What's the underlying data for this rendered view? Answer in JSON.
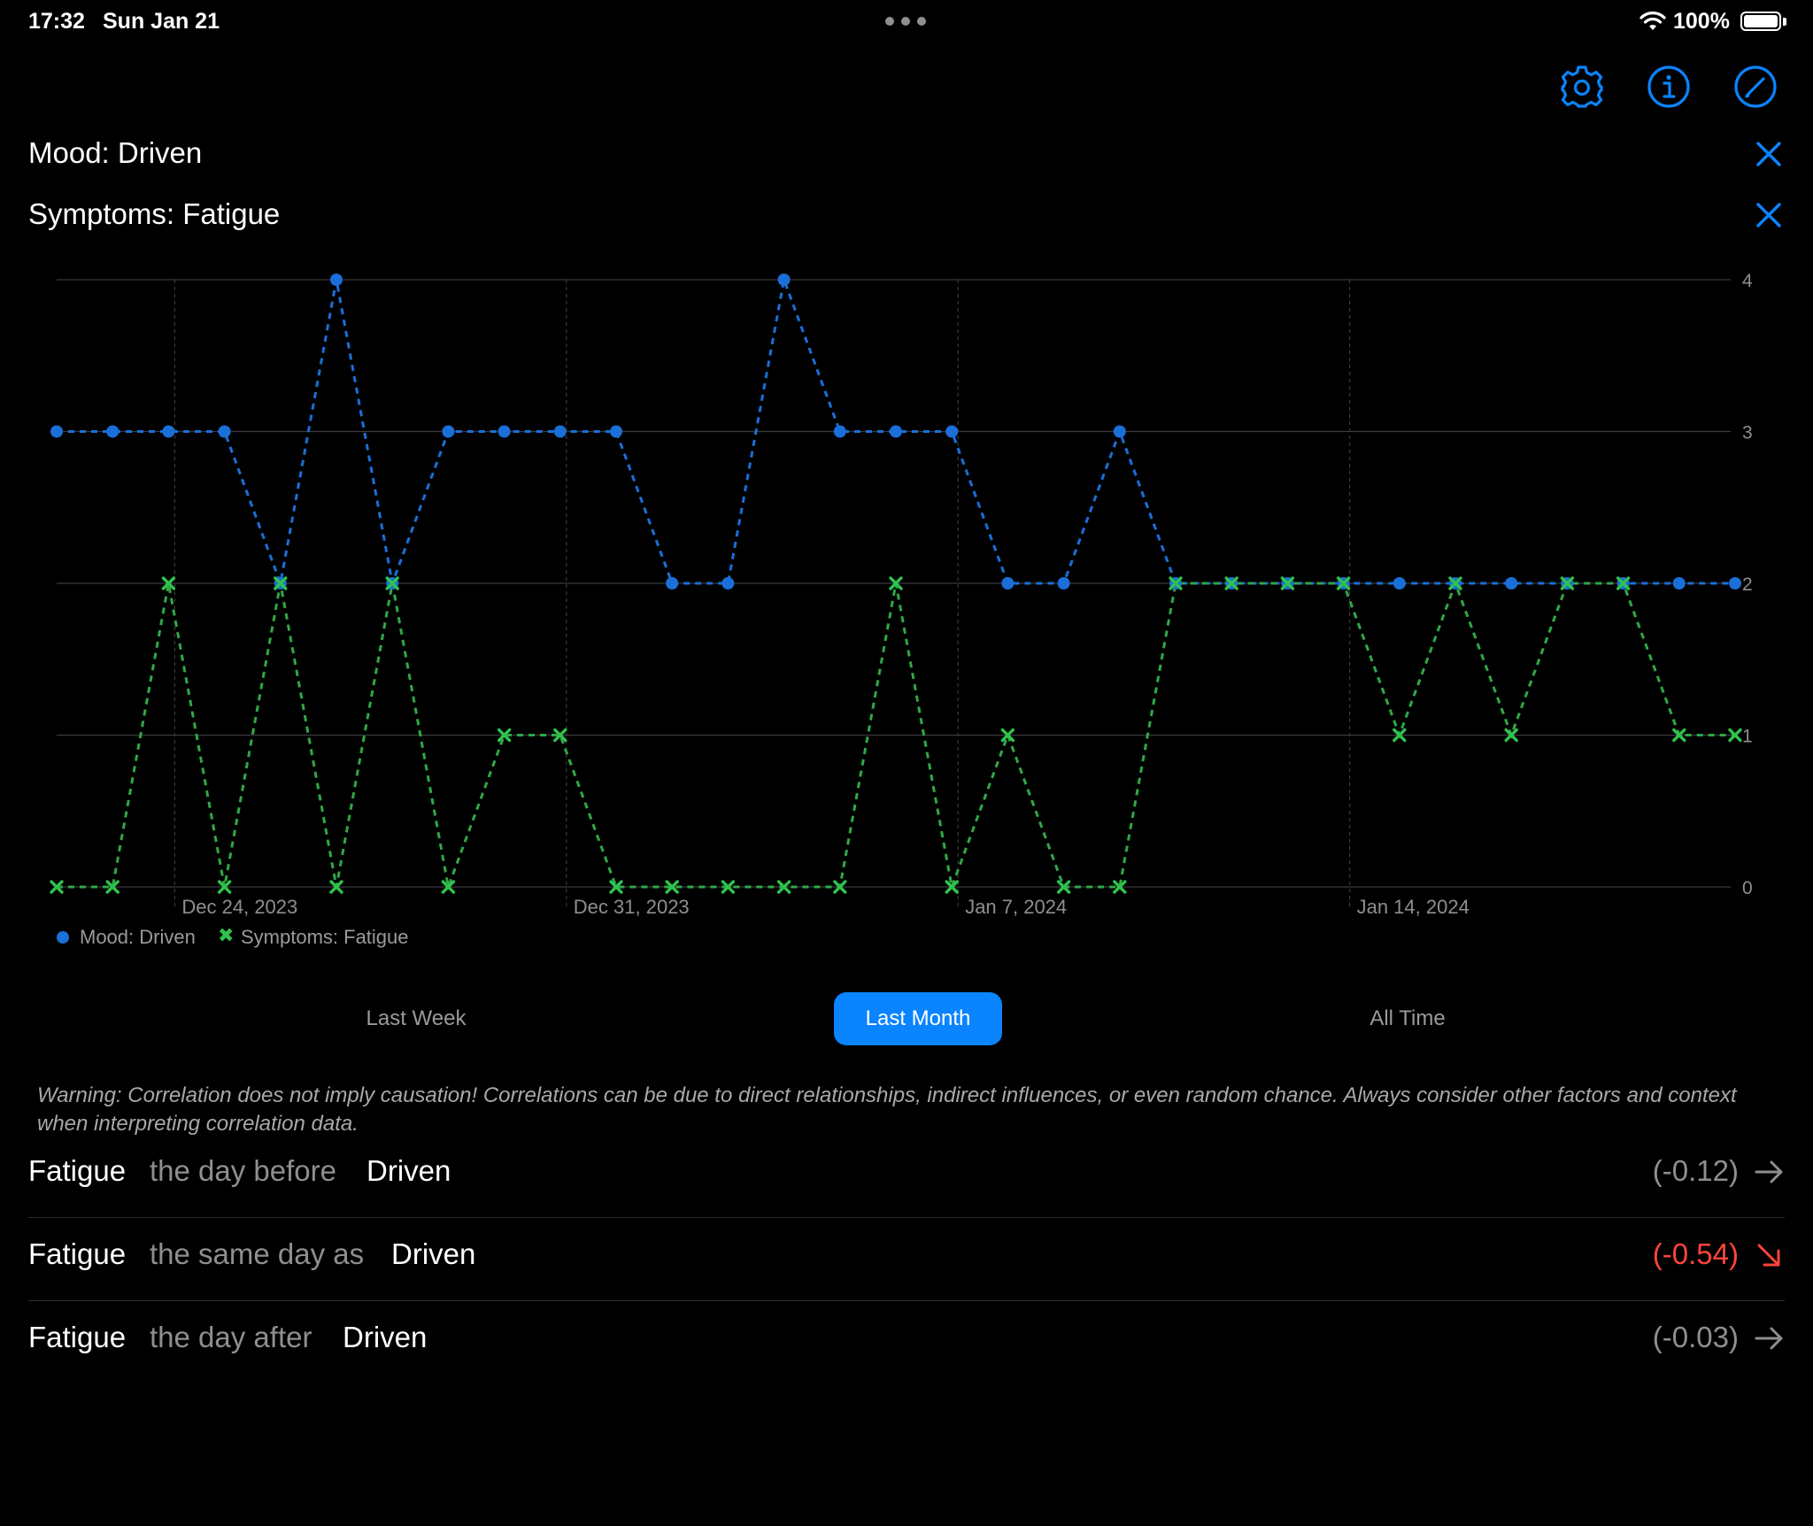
{
  "status_bar": {
    "time": "17:32",
    "date": "Sun Jan 21",
    "battery": "100%"
  },
  "toolbar": {
    "icons": [
      "gear-icon",
      "info-icon",
      "compose-icon"
    ],
    "accent": "#0a84ff"
  },
  "filters": [
    {
      "label": "Mood: Driven"
    },
    {
      "label": "Symptoms: Fatigue"
    }
  ],
  "chart_data": {
    "type": "line",
    "x_axis": {
      "ticks": [
        "Dec 24, 2023",
        "Dec 31, 2023",
        "Jan 7, 2024",
        "Jan 14, 2024"
      ],
      "start": "2023-12-22",
      "end": "2024-01-21"
    },
    "y_axis": {
      "ticks": [
        "0",
        "1",
        "2",
        "3",
        "4"
      ],
      "ylim": [
        0,
        4
      ],
      "position": "right"
    },
    "grid": true,
    "legend_position": "bottom-left",
    "series": [
      {
        "name": "Mood: Driven",
        "marker": "circle",
        "line": "dashed",
        "color": "#1a6fd8",
        "points": [
          {
            "x": "2023-12-22",
            "y": 3
          },
          {
            "x": "2023-12-23",
            "y": 3
          },
          {
            "x": "2023-12-24",
            "y": 3
          },
          {
            "x": "2023-12-25",
            "y": 3
          },
          {
            "x": "2023-12-26",
            "y": 2
          },
          {
            "x": "2023-12-27",
            "y": 4
          },
          {
            "x": "2023-12-28",
            "y": 2
          },
          {
            "x": "2023-12-29",
            "y": 3
          },
          {
            "x": "2023-12-30",
            "y": 3
          },
          {
            "x": "2023-12-31",
            "y": 3
          },
          {
            "x": "2024-01-01",
            "y": 3
          },
          {
            "x": "2024-01-02",
            "y": 2
          },
          {
            "x": "2024-01-03",
            "y": 2
          },
          {
            "x": "2024-01-04",
            "y": 4
          },
          {
            "x": "2024-01-05",
            "y": 3
          },
          {
            "x": "2024-01-06",
            "y": 3
          },
          {
            "x": "2024-01-07",
            "y": 3
          },
          {
            "x": "2024-01-08",
            "y": 2
          },
          {
            "x": "2024-01-09",
            "y": 2
          },
          {
            "x": "2024-01-10",
            "y": 3
          },
          {
            "x": "2024-01-11",
            "y": 2
          },
          {
            "x": "2024-01-12",
            "y": 2
          },
          {
            "x": "2024-01-13",
            "y": 2
          },
          {
            "x": "2024-01-14",
            "y": 2
          },
          {
            "x": "2024-01-15",
            "y": 2
          },
          {
            "x": "2024-01-16",
            "y": 2
          },
          {
            "x": "2024-01-17",
            "y": 2
          },
          {
            "x": "2024-01-18",
            "y": 2
          },
          {
            "x": "2024-01-19",
            "y": 2
          },
          {
            "x": "2024-01-20",
            "y": 2
          },
          {
            "x": "2024-01-21",
            "y": 2
          }
        ]
      },
      {
        "name": "Symptoms: Fatigue",
        "marker": "cross",
        "line": "dashed",
        "color": "#2fa847",
        "points": [
          {
            "x": "2023-12-22",
            "y": 0
          },
          {
            "x": "2023-12-23",
            "y": 0
          },
          {
            "x": "2023-12-24",
            "y": 2
          },
          {
            "x": "2023-12-25",
            "y": 0
          },
          {
            "x": "2023-12-26",
            "y": 2
          },
          {
            "x": "2023-12-27",
            "y": 0
          },
          {
            "x": "2023-12-28",
            "y": 2
          },
          {
            "x": "2023-12-29",
            "y": 0
          },
          {
            "x": "2023-12-30",
            "y": 1
          },
          {
            "x": "2023-12-31",
            "y": 1
          },
          {
            "x": "2024-01-01",
            "y": 0
          },
          {
            "x": "2024-01-02",
            "y": 0
          },
          {
            "x": "2024-01-03",
            "y": 0
          },
          {
            "x": "2024-01-04",
            "y": 0
          },
          {
            "x": "2024-01-05",
            "y": 0
          },
          {
            "x": "2024-01-06",
            "y": 2
          },
          {
            "x": "2024-01-07",
            "y": 0
          },
          {
            "x": "2024-01-08",
            "y": 1
          },
          {
            "x": "2024-01-09",
            "y": 0
          },
          {
            "x": "2024-01-10",
            "y": 0
          },
          {
            "x": "2024-01-11",
            "y": 2
          },
          {
            "x": "2024-01-12",
            "y": 2
          },
          {
            "x": "2024-01-13",
            "y": 2
          },
          {
            "x": "2024-01-14",
            "y": 2
          },
          {
            "x": "2024-01-15",
            "y": 1
          },
          {
            "x": "2024-01-16",
            "y": 2
          },
          {
            "x": "2024-01-17",
            "y": 1
          },
          {
            "x": "2024-01-18",
            "y": 2
          },
          {
            "x": "2024-01-19",
            "y": 2
          },
          {
            "x": "2024-01-20",
            "y": 1
          },
          {
            "x": "2024-01-21",
            "y": 1
          }
        ]
      }
    ]
  },
  "time_range": {
    "options": [
      "Last Week",
      "Last Month",
      "All Time"
    ],
    "selected": "Last Month"
  },
  "warning": "Warning: Correlation does not imply causation! Correlations can be due to direct relationships, indirect influences, or even random chance. Always consider other factors and context when interpreting correlation data.",
  "correlations": [
    {
      "subject": "Fatigue",
      "relation": "the day before",
      "object": "Driven",
      "value": "(-0.12)",
      "arrow": "arrow-right-icon",
      "negative": false
    },
    {
      "subject": "Fatigue",
      "relation": "the same day as",
      "object": "Driven",
      "value": "(-0.54)",
      "arrow": "arrow-down-right-icon",
      "negative": true
    },
    {
      "subject": "Fatigue",
      "relation": "the day after",
      "object": "Driven",
      "value": "(-0.03)",
      "arrow": "arrow-right-icon",
      "negative": false
    }
  ]
}
